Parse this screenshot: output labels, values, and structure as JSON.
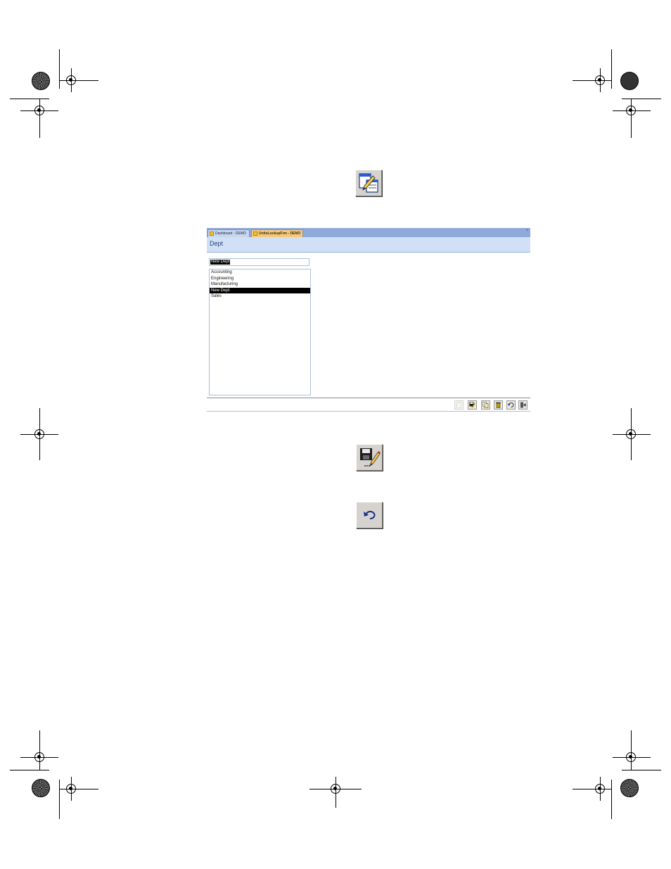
{
  "icons": {
    "edit_form_icon": "edit-form-icon",
    "save_edit_icon": "save-edit-icon",
    "undo_icon": "undo-icon"
  },
  "window": {
    "tabs": [
      {
        "label": "Dashboard - DEMO",
        "active": false
      },
      {
        "label": "UnitsLookupFrm - DEMO",
        "active": true
      }
    ],
    "close_glyph": "×",
    "header_title": "Dept",
    "name_field_value": "New Dept",
    "list_items": [
      "Accounting",
      "Engineering",
      "Manufacturing",
      "New Dept",
      "Sales"
    ],
    "selected_item": "New Dept",
    "toolbar_buttons": [
      {
        "icon": "new-record-icon",
        "enabled": false
      },
      {
        "icon": "save-edit-icon",
        "enabled": true
      },
      {
        "icon": "copy-record-icon",
        "enabled": true
      },
      {
        "icon": "delete-icon",
        "enabled": true
      },
      {
        "icon": "undo-icon",
        "enabled": true
      },
      {
        "icon": "exit-icon",
        "enabled": true
      }
    ]
  },
  "colors": {
    "tab_bar": "#8eaadb",
    "active_tab": "#f7c87a",
    "header_band": "#cfe0f7",
    "selection": "#000000"
  }
}
